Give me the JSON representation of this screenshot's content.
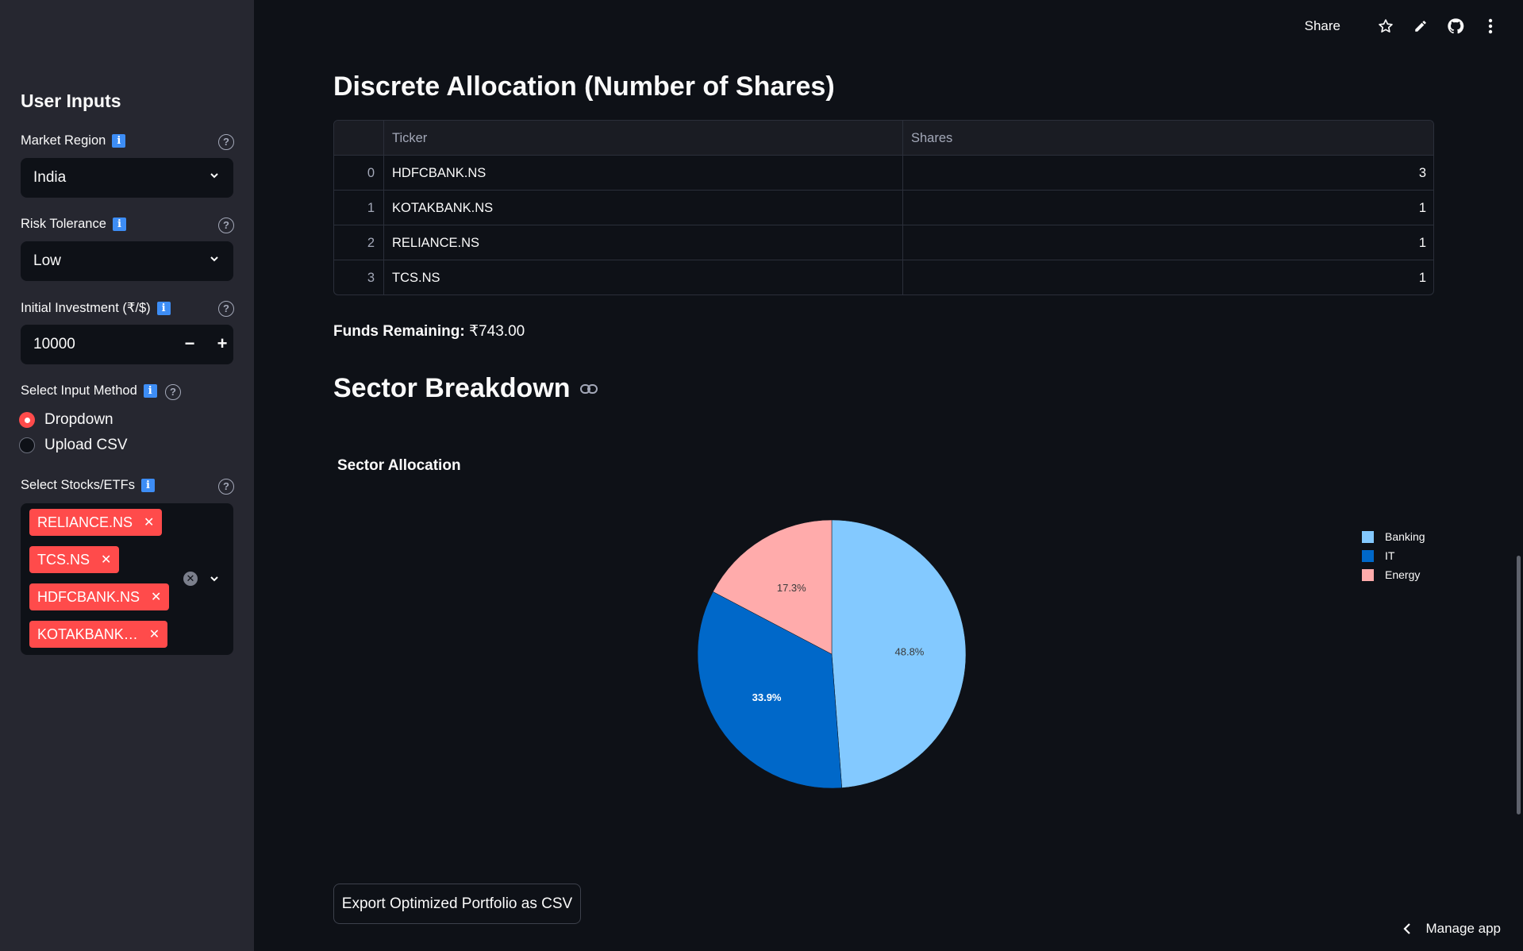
{
  "sidebar": {
    "title": "User Inputs",
    "market_region": {
      "label": "Market Region",
      "value": "India"
    },
    "risk_tolerance": {
      "label": "Risk Tolerance",
      "value": "Low"
    },
    "initial_investment": {
      "label": "Initial Investment (₹/$)",
      "value": "10000"
    },
    "input_method": {
      "label": "Select Input Method",
      "options": [
        "Dropdown",
        "Upload CSV"
      ],
      "selected": "Dropdown"
    },
    "stocks": {
      "label": "Select Stocks/ETFs",
      "selected": [
        "RELIANCE.NS",
        "TCS.NS",
        "HDFCBANK.NS",
        "KOTAKBANK…"
      ]
    }
  },
  "toolbar": {
    "share_label": "Share"
  },
  "main": {
    "allocation_title": "Discrete Allocation (Number of Shares)",
    "table": {
      "columns": [
        "",
        "Ticker",
        "Shares"
      ],
      "rows": [
        {
          "index": "0",
          "ticker": "HDFCBANK.NS",
          "shares": "3"
        },
        {
          "index": "1",
          "ticker": "KOTAKBANK.NS",
          "shares": "1"
        },
        {
          "index": "2",
          "ticker": "RELIANCE.NS",
          "shares": "1"
        },
        {
          "index": "3",
          "ticker": "TCS.NS",
          "shares": "1"
        }
      ]
    },
    "funds_label": "Funds Remaining:",
    "funds_value": "₹743.00",
    "sector_title": "Sector Breakdown",
    "export_label": "Export Optimized Portfolio as CSV",
    "manage_label": "Manage app"
  },
  "chart_data": {
    "type": "pie",
    "title": "Sector Allocation",
    "labels": [
      "Banking",
      "IT",
      "Energy"
    ],
    "values": [
      48.8,
      33.9,
      17.3
    ],
    "value_labels": [
      "48.8%",
      "33.9%",
      "17.3%"
    ],
    "colors": [
      "#83c9ff",
      "#0068c9",
      "#ffabab"
    ],
    "label_colors": [
      "#3a3a3a",
      "#ffffff",
      "#3a3a3a"
    ],
    "legend": "top-right"
  }
}
